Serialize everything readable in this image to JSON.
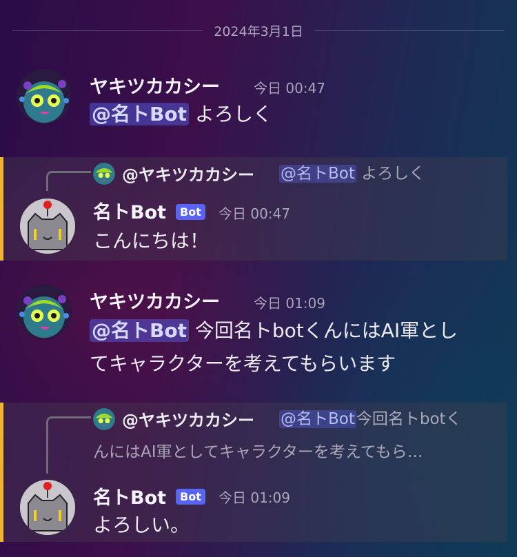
{
  "date_divider": "2024年3月1日",
  "messages": [
    {
      "author": "ヤキツカカシー",
      "time": "今日 00:47",
      "mention": "@名トBot",
      "text": "よろしく"
    },
    {
      "reply_author": "@ヤキツカカシー",
      "reply_mention": "@名トBot",
      "reply_text": "よろしく",
      "author": "名トBot",
      "badge": "Bot",
      "time": "今日 00:47",
      "text": "こんにちは！"
    },
    {
      "author": "ヤキツカカシー",
      "time": "今日 01:09",
      "mention": "@名トBot",
      "text_line1": "今回名トbotくんにはAI軍とし",
      "text_line2": "てキャラクターを考えてもらいます"
    },
    {
      "reply_author": "@ヤキツカカシー",
      "reply_mention": "@名トBot",
      "reply_text_line1": "今回名トbotく",
      "reply_text_line2": "んにはAI軍としてキャラクターを考えてもら…",
      "author": "名トBot",
      "badge": "Bot",
      "time": "今日 01:09",
      "text": "よろしい。"
    }
  ]
}
